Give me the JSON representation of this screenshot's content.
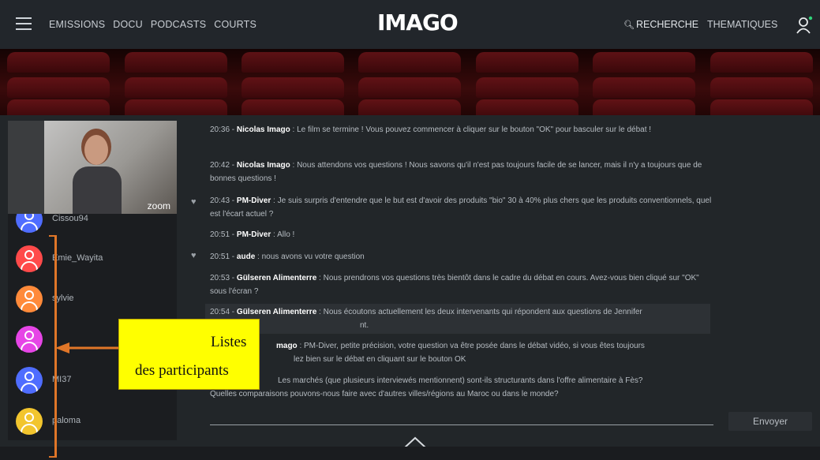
{
  "nav": {
    "items": [
      "EMISSIONS",
      "DOCU",
      "PODCASTS",
      "COURTS"
    ],
    "logo": "IMAGO",
    "search": "RECHERCHE",
    "thematiques": "THEMATIQUES"
  },
  "video": {
    "label": "zoom"
  },
  "participants": [
    {
      "name": "Cissou94",
      "color": "#4f6dff"
    },
    {
      "name": "Emie_Wayita",
      "color": "#ff4a4a"
    },
    {
      "name": "sylvie",
      "color": "#ff8a3a"
    },
    {
      "name": "",
      "color": "#e645e6"
    },
    {
      "name": "MI37",
      "color": "#4f6dff"
    },
    {
      "name": "paloma",
      "color": "#f2c52e"
    }
  ],
  "messages": [
    {
      "time": "20:36",
      "author": "Nicolas Imago",
      "text": "Le film se termine ! Vous pouvez commencer à cliquer sur le bouton \"OK\" pour basculer sur le débat !"
    },
    {
      "time": "20:42",
      "author": "Nicolas Imago",
      "text": "Nous attendons vos questions ! Nous savons qu'il n'est pas toujours facile de se lancer, mais il n'y a toujours que de bonnes questions !"
    },
    {
      "time": "20:43",
      "author": "PM-Diver",
      "text": "Je suis surpris d'entendre que le but est d'avoir des produits \"bio\" 30 à 40% plus chers que les produits conventionnels, quel est l'écart actuel ?"
    },
    {
      "time": "20:51",
      "author": "PM-Diver",
      "text": "Allo !"
    },
    {
      "time": "20:51",
      "author": "aude",
      "text": "nous avons vu votre question"
    },
    {
      "time": "20:53",
      "author": "Gülseren Alimenterre",
      "text": "Nous prendrons vos questions très bientôt dans le cadre du débat en cours. Avez-vous bien cliqué sur \"OK\" sous l'écran ?"
    },
    {
      "time": "20:54",
      "author": "Gülseren Alimenterre",
      "text": "Nous écoutons actuellement les deux intervenants qui répondent aux questions de Jennifer",
      "text_line2": "nt."
    },
    {
      "time": "",
      "author": "mago",
      "text": "PM-Diver, petite précision, votre question va être posée dans le débat vidéo, si vous êtes toujours",
      "text_line2": "lez bien sur le débat en cliquant sur le bouton OK"
    },
    {
      "time": "",
      "author": "",
      "text": "Les marchés (que plusieurs interviewés mentionnent) sont-ils structurants dans l'offre alimentaire à Fès?",
      "text_line2": "aisons pouvons-nous faire avec d'autres villes/régions au Maroc ou dans le monde?",
      "text_line2_prefix": "Quelles compar"
    }
  ],
  "send_label": "Envoyer",
  "callout": {
    "line1": "Listes",
    "line2": "des participants"
  },
  "colors": {
    "accent": "#e07628",
    "callout_bg": "#ffff00",
    "topbar": "#22262b",
    "panel": "#222629"
  }
}
